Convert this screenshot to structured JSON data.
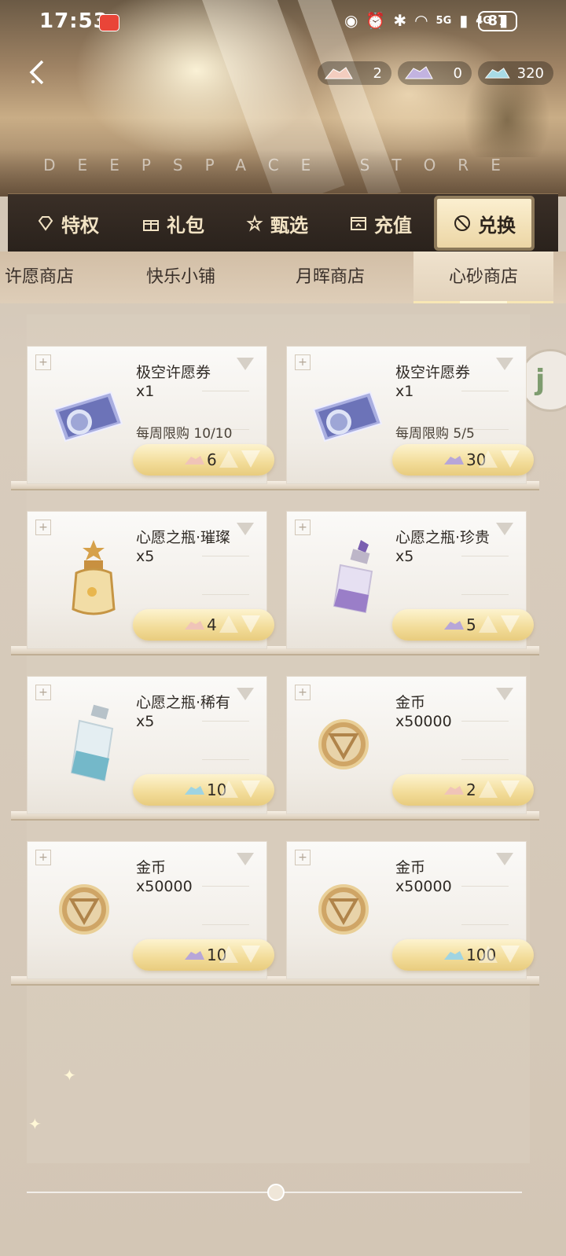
{
  "status_bar": {
    "time": "17:53",
    "signal_5g": "5G",
    "signal_4g": "4G",
    "battery": "87"
  },
  "header": {
    "brand_text": "DEEPSPACE STORE",
    "currencies": [
      {
        "icon": "pink-crystal-sand-icon",
        "value": "2",
        "color": "#f0c4b8"
      },
      {
        "icon": "purple-crystal-sand-icon",
        "value": "0",
        "color": "#b7a6d8"
      },
      {
        "icon": "blue-crystal-sand-icon",
        "value": "320",
        "color": "#9fd4e2"
      }
    ]
  },
  "categories": [
    {
      "icon": "diamond-icon",
      "label": "特权",
      "active": false
    },
    {
      "icon": "gift-icon",
      "label": "礼包",
      "active": false
    },
    {
      "icon": "star-frame-icon",
      "label": "甄选",
      "active": false
    },
    {
      "icon": "recharge-icon",
      "label": "充值",
      "active": false
    },
    {
      "icon": "exchange-icon",
      "label": "兑换",
      "active": true
    }
  ],
  "sub_tabs": [
    {
      "label": "许愿商店",
      "active": false
    },
    {
      "label": "快乐小铺",
      "active": false
    },
    {
      "label": "月晖商店",
      "active": false
    },
    {
      "label": "心砂商店",
      "active": true
    }
  ],
  "items": [
    {
      "name": "极空许愿券",
      "qty": "x1",
      "limit": "每周限购 10/10",
      "image": "wish-ticket-icon",
      "currency": "pink-crystal-sand-icon",
      "price": "6"
    },
    {
      "name": "极空许愿券",
      "qty": "x1",
      "limit": "每周限购 5/5",
      "image": "wish-ticket-icon",
      "currency": "purple-crystal-sand-icon",
      "price": "30"
    },
    {
      "name": "心愿之瓶·璀璨",
      "qty": "x5",
      "limit": "",
      "image": "gold-wish-bottle-icon",
      "currency": "pink-crystal-sand-icon",
      "price": "4"
    },
    {
      "name": "心愿之瓶·珍贵",
      "qty": "x5",
      "limit": "",
      "image": "purple-wish-bottle-icon",
      "currency": "purple-crystal-sand-icon",
      "price": "5"
    },
    {
      "name": "心愿之瓶·稀有",
      "qty": "x5",
      "limit": "",
      "image": "blue-wish-bottle-icon",
      "currency": "blue-crystal-sand-icon",
      "price": "10"
    },
    {
      "name": "金币",
      "qty": "x50000",
      "limit": "",
      "image": "gold-coin-icon",
      "currency": "pink-crystal-sand-icon",
      "price": "2"
    },
    {
      "name": "金币",
      "qty": "x50000",
      "limit": "",
      "image": "gold-coin-icon",
      "currency": "purple-crystal-sand-icon",
      "price": "10"
    },
    {
      "name": "金币",
      "qty": "x50000",
      "limit": "",
      "image": "gold-coin-icon",
      "currency": "blue-crystal-sand-icon",
      "price": "100"
    }
  ],
  "side": {
    "bubble_text": "j"
  },
  "colors": {
    "category_bar_bg": "#2a221c",
    "active_tab_gold": "#ecd6a5",
    "price_button_gold": "#f2dc98",
    "pink_gem": "#f0c4b8",
    "purple_gem": "#b7a6d8",
    "blue_gem": "#9fd4e2"
  }
}
